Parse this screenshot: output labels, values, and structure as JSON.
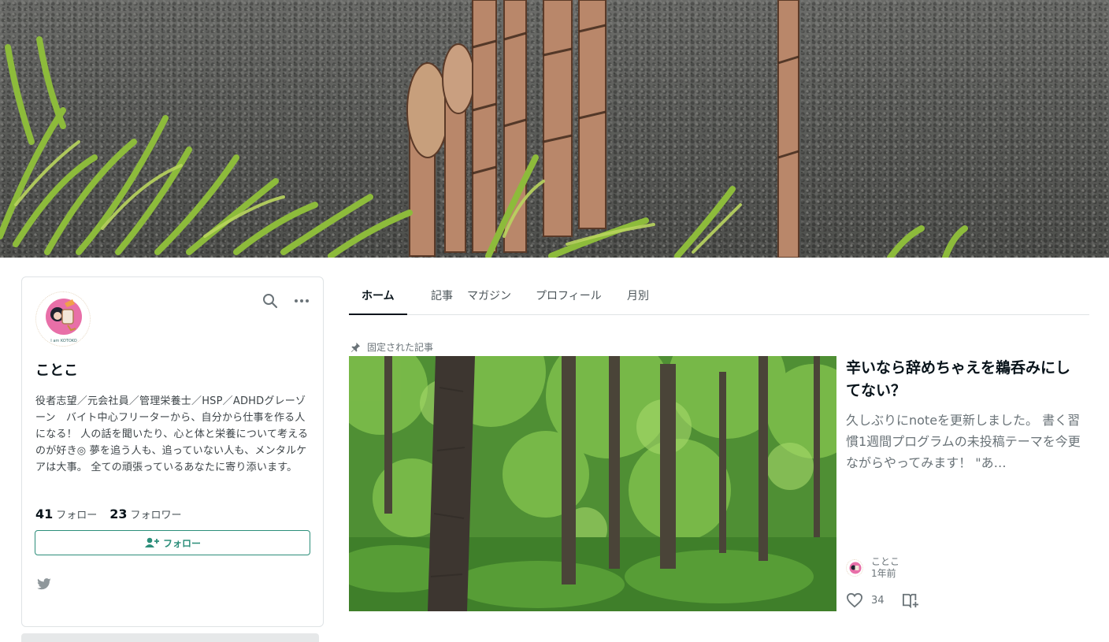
{
  "profile": {
    "name": "ことこ",
    "bio": "役者志望／元会社員／管理栄養士／HSP／ADHDグレーゾーン　バイト中心フリーターから、自分から仕事を作る人になる！ 人の話を聞いたり、心と体と栄養について考えるのが好き◎ 夢を追う人も、追っていない人も、メンタルケアは大事。 全ての頑張っているあなたに寄り添います。",
    "following_count": "41",
    "following_label": "フォロー",
    "followers_count": "23",
    "followers_label": "フォロワー",
    "follow_button_label": "フォロー",
    "avatar_caption": "I am KOTOKO"
  },
  "tabs": [
    {
      "label": "ホーム",
      "active": true
    },
    {
      "label": "記事",
      "active": false
    },
    {
      "label": "マガジン",
      "active": false
    },
    {
      "label": "プロフィール",
      "active": false
    },
    {
      "label": "月別",
      "active": false
    }
  ],
  "pinned": {
    "label": "固定された記事",
    "title": "辛いなら辞めちゃえを鵜呑みにしてない？",
    "excerpt": "久しぶりにnoteを更新しました。 書く習慣1週間プログラムの未投稿テーマを今更ながらやってみます！ \"あ…",
    "author": "ことこ",
    "time": "1年前",
    "likes": "34"
  },
  "icons": {
    "search": "search-icon",
    "more": "more-horizontal-icon",
    "follow": "user-plus-icon",
    "twitter": "twitter-icon",
    "pin": "pin-icon",
    "like": "heart-icon",
    "magazine": "magazine-add-icon"
  },
  "colors": {
    "accent": "#2c8e7a",
    "text": "#08131a",
    "muted": "#6a7378",
    "border": "#dfe3e5"
  }
}
